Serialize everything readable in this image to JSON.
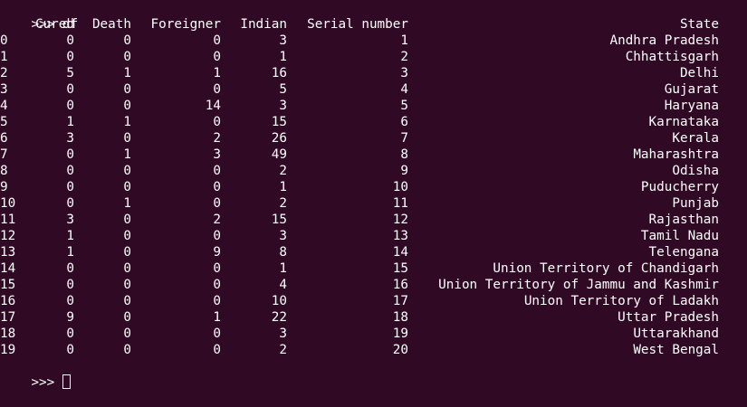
{
  "prompt": ">>> ",
  "command": "df",
  "columns": {
    "cured": "Cured",
    "death": "Death",
    "foreigner": "Foreigner",
    "indian": "Indian",
    "serial": "Serial number",
    "state": "State"
  },
  "rows": [
    {
      "idx": "0",
      "cured": "0",
      "death": "0",
      "foreigner": "0",
      "indian": "3",
      "serial": "1",
      "state": "Andhra Pradesh"
    },
    {
      "idx": "1",
      "cured": "0",
      "death": "0",
      "foreigner": "0",
      "indian": "1",
      "serial": "2",
      "state": "Chhattisgarh"
    },
    {
      "idx": "2",
      "cured": "5",
      "death": "1",
      "foreigner": "1",
      "indian": "16",
      "serial": "3",
      "state": "Delhi"
    },
    {
      "idx": "3",
      "cured": "0",
      "death": "0",
      "foreigner": "0",
      "indian": "5",
      "serial": "4",
      "state": "Gujarat"
    },
    {
      "idx": "4",
      "cured": "0",
      "death": "0",
      "foreigner": "14",
      "indian": "3",
      "serial": "5",
      "state": "Haryana"
    },
    {
      "idx": "5",
      "cured": "1",
      "death": "1",
      "foreigner": "0",
      "indian": "15",
      "serial": "6",
      "state": "Karnataka"
    },
    {
      "idx": "6",
      "cured": "3",
      "death": "0",
      "foreigner": "2",
      "indian": "26",
      "serial": "7",
      "state": "Kerala"
    },
    {
      "idx": "7",
      "cured": "0",
      "death": "1",
      "foreigner": "3",
      "indian": "49",
      "serial": "8",
      "state": "Maharashtra"
    },
    {
      "idx": "8",
      "cured": "0",
      "death": "0",
      "foreigner": "0",
      "indian": "2",
      "serial": "9",
      "state": "Odisha"
    },
    {
      "idx": "9",
      "cured": "0",
      "death": "0",
      "foreigner": "0",
      "indian": "1",
      "serial": "10",
      "state": "Puducherry"
    },
    {
      "idx": "10",
      "cured": "0",
      "death": "1",
      "foreigner": "0",
      "indian": "2",
      "serial": "11",
      "state": "Punjab"
    },
    {
      "idx": "11",
      "cured": "3",
      "death": "0",
      "foreigner": "2",
      "indian": "15",
      "serial": "12",
      "state": "Rajasthan"
    },
    {
      "idx": "12",
      "cured": "1",
      "death": "0",
      "foreigner": "0",
      "indian": "3",
      "serial": "13",
      "state": "Tamil Nadu"
    },
    {
      "idx": "13",
      "cured": "1",
      "death": "0",
      "foreigner": "9",
      "indian": "8",
      "serial": "14",
      "state": "Telengana"
    },
    {
      "idx": "14",
      "cured": "0",
      "death": "0",
      "foreigner": "0",
      "indian": "1",
      "serial": "15",
      "state": "Union Territory of Chandigarh"
    },
    {
      "idx": "15",
      "cured": "0",
      "death": "0",
      "foreigner": "0",
      "indian": "4",
      "serial": "16",
      "state": "Union Territory of Jammu and Kashmir"
    },
    {
      "idx": "16",
      "cured": "0",
      "death": "0",
      "foreigner": "0",
      "indian": "10",
      "serial": "17",
      "state": "Union Territory of Ladakh"
    },
    {
      "idx": "17",
      "cured": "9",
      "death": "0",
      "foreigner": "1",
      "indian": "22",
      "serial": "18",
      "state": "Uttar Pradesh"
    },
    {
      "idx": "18",
      "cured": "0",
      "death": "0",
      "foreigner": "0",
      "indian": "3",
      "serial": "19",
      "state": "Uttarakhand"
    },
    {
      "idx": "19",
      "cured": "0",
      "death": "0",
      "foreigner": "0",
      "indian": "2",
      "serial": "20",
      "state": "West Bengal"
    }
  ],
  "theme": {
    "background": "#300a24",
    "foreground": "#ffffff"
  }
}
